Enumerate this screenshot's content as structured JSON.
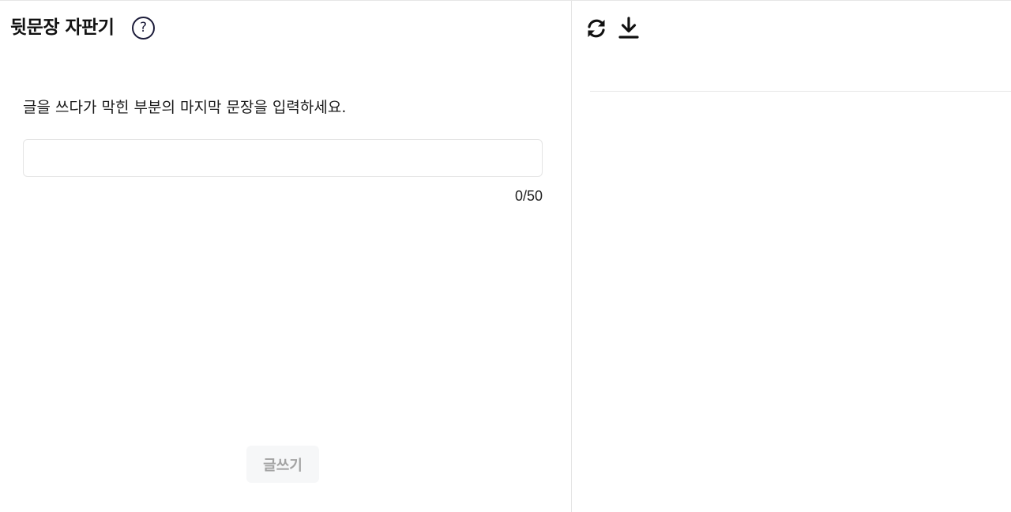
{
  "left_panel": {
    "title": "뒷문장 자판기",
    "help_icon": "help-circle-icon",
    "help_glyph": "?",
    "instruction": "글을 쓰다가 막힌 부분의 마지막 문장을 입력하세요.",
    "input": {
      "value": "",
      "placeholder": ""
    },
    "counter": "0/50",
    "write_button_label": "글쓰기"
  },
  "right_panel": {
    "toolbar": {
      "refresh_icon": "refresh-icon",
      "download_icon": "download-icon"
    }
  },
  "colors": {
    "icon": "#1c1c3a",
    "button_bg_disabled": "#f6f7f8",
    "button_text_disabled": "#a3a3a3",
    "border": "#e4e4e4"
  }
}
